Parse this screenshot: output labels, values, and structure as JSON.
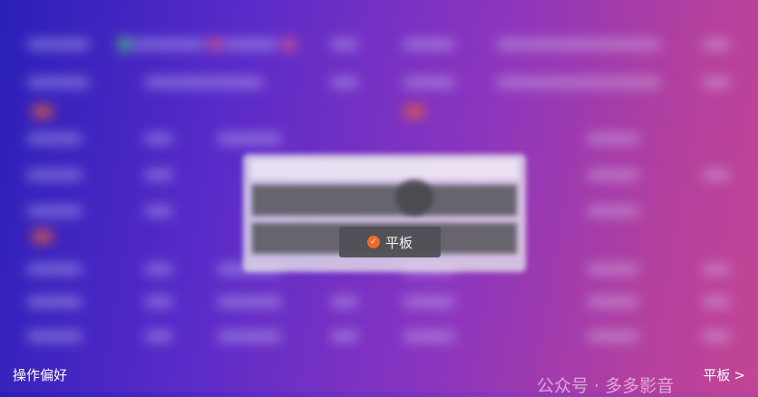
{
  "dialog": {
    "selected_option": "平板",
    "check_color": "#f06a22"
  },
  "footer": {
    "left_label": "操作偏好",
    "right_value": "平板",
    "right_chevron": ">"
  },
  "watermark": {
    "text": "公众号 · 多多影音"
  },
  "icons": {
    "check": "check-icon",
    "chevron": "chevron-right-icon"
  }
}
